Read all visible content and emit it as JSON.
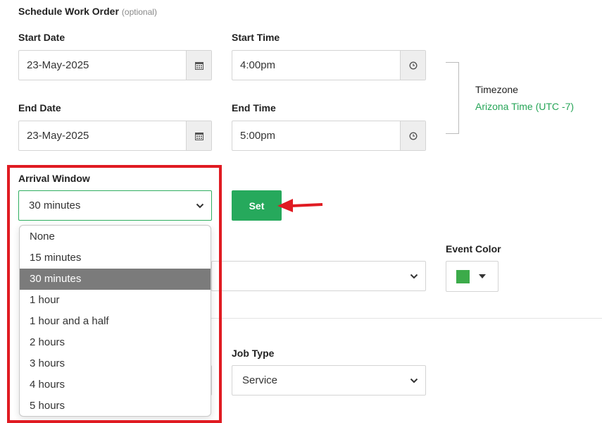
{
  "section": {
    "title": "Schedule Work Order",
    "optional": "(optional)"
  },
  "start_date": {
    "label": "Start Date",
    "value": "23-May-2025"
  },
  "start_time": {
    "label": "Start Time",
    "value": "4:00pm"
  },
  "end_date": {
    "label": "End Date",
    "value": "23-May-2025"
  },
  "end_time": {
    "label": "End Time",
    "value": "5:00pm"
  },
  "timezone": {
    "label": "Timezone",
    "value": "Arizona Time (UTC -7)"
  },
  "arrival_window": {
    "label": "Arrival Window",
    "selected": "30 minutes",
    "options": [
      "None",
      "15 minutes",
      "30 minutes",
      "1 hour",
      "1 hour and a half",
      "2 hours",
      "3 hours",
      "4 hours",
      "5 hours"
    ],
    "selected_index": 2
  },
  "set_button": {
    "label": "Set"
  },
  "event_color": {
    "label": "Event Color",
    "color": "#3cab4a"
  },
  "job_type": {
    "label": "Job Type",
    "value": "Service"
  },
  "colors": {
    "accent_green": "#26a95c",
    "highlight_red": "#e01b22",
    "timezone_green": "#27a558"
  }
}
